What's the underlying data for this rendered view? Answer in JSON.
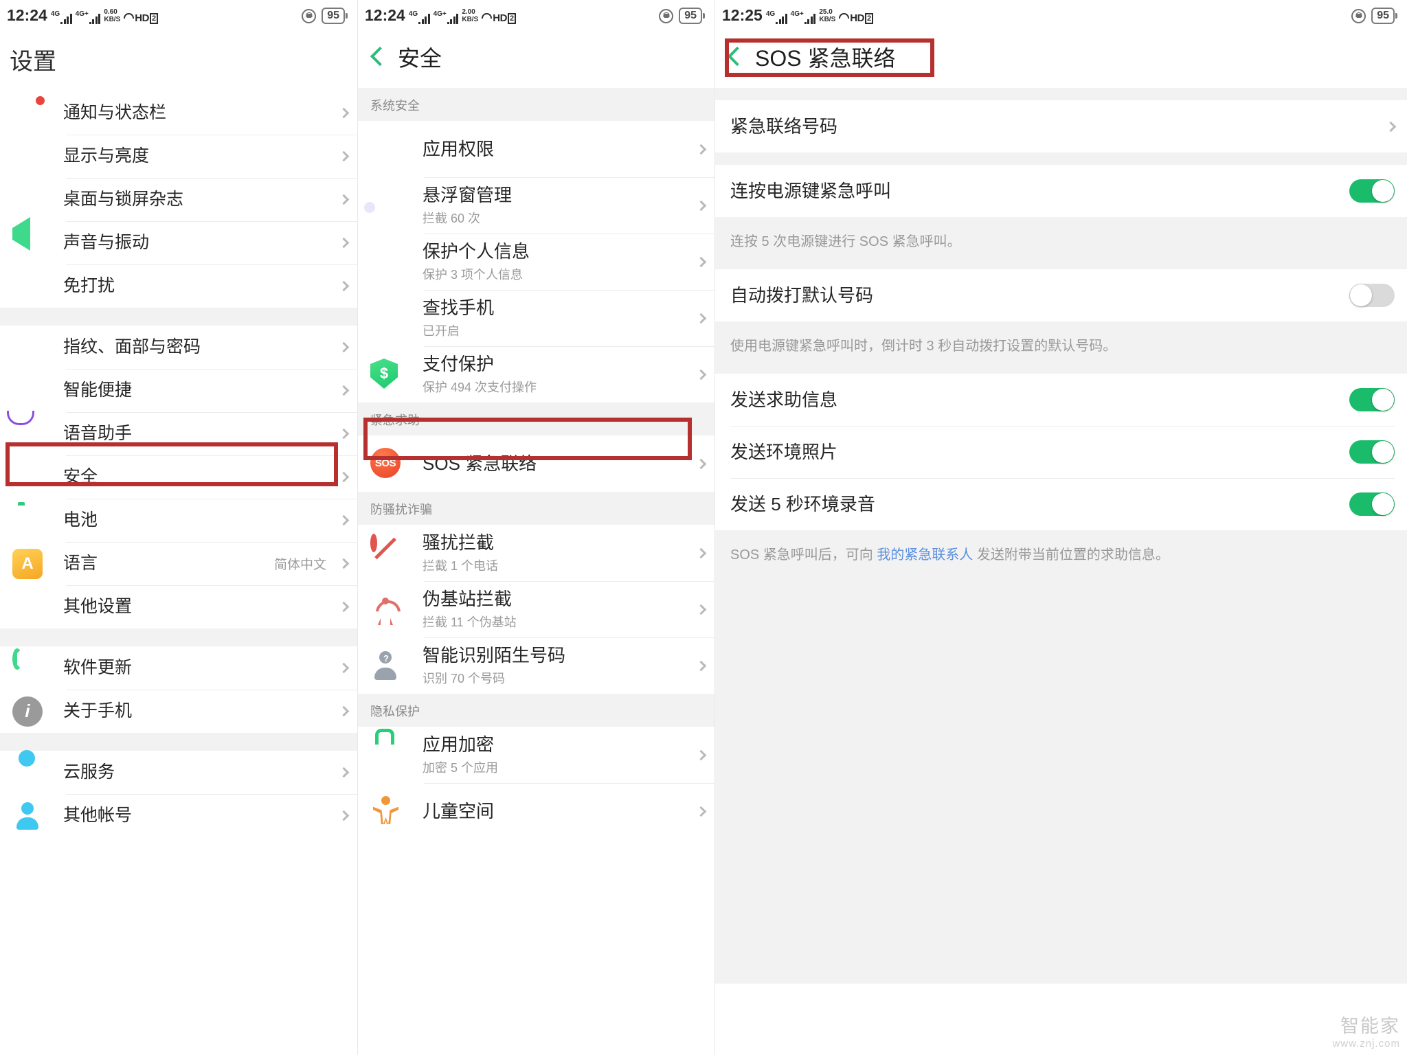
{
  "panels": [
    {
      "status": {
        "time": "12:24",
        "net_speed": "0.60",
        "net_unit": "KB/S",
        "sim1": "4G",
        "sim2": "4G+",
        "volte": "HD",
        "sim_badge": "2",
        "battery": "95"
      },
      "title": "设置",
      "groups": [
        {
          "items": [
            {
              "label": "通知与状态栏",
              "icon": "notification-icon",
              "badge": true
            },
            {
              "label": "显示与亮度",
              "icon": "display-brightness-icon"
            },
            {
              "label": "桌面与锁屏杂志",
              "icon": "wallpaper-icon"
            },
            {
              "label": "声音与振动",
              "icon": "sound-vibration-icon"
            },
            {
              "label": "免打扰",
              "icon": "do-not-disturb-moon-icon"
            }
          ]
        },
        {
          "items": [
            {
              "label": "指纹、面部与密码",
              "icon": "fingerprint-face-icon"
            },
            {
              "label": "智能便捷",
              "icon": "smart-convenience-icon"
            },
            {
              "label": "语音助手",
              "icon": "voice-assistant-mic-icon"
            },
            {
              "label": "安全",
              "icon": "security-shield-icon",
              "highlighted": true
            },
            {
              "label": "电池",
              "icon": "battery-icon"
            },
            {
              "label": "语言",
              "icon": "language-icon",
              "value": "简体中文"
            },
            {
              "label": "其他设置",
              "icon": "gear-icon"
            }
          ]
        },
        {
          "items": [
            {
              "label": "软件更新",
              "icon": "software-update-icon"
            },
            {
              "label": "关于手机",
              "icon": "about-phone-info-icon"
            }
          ]
        },
        {
          "items": [
            {
              "label": "云服务",
              "icon": "cloud-icon"
            },
            {
              "label": "其他帐号",
              "icon": "account-person-icon"
            }
          ]
        }
      ]
    },
    {
      "status": {
        "time": "12:24",
        "net_speed": "2.00",
        "net_unit": "KB/S",
        "sim1": "4G",
        "sim2": "4G+",
        "volte": "HD",
        "sim_badge": "2",
        "battery": "95"
      },
      "title": "安全",
      "back_label": "返回",
      "groups": [
        {
          "header": "系统安全",
          "items": [
            {
              "label": "应用权限",
              "icon": "app-permission-shield-icon"
            },
            {
              "label": "悬浮窗管理",
              "sub": "拦截 60 次",
              "icon": "floating-window-icon"
            },
            {
              "label": "保护个人信息",
              "sub": "保护 3 项个人信息",
              "icon": "personal-info-shield-icon"
            },
            {
              "label": "查找手机",
              "sub": "已开启",
              "icon": "find-phone-icon"
            },
            {
              "label": "支付保护",
              "sub": "保护 494 次支付操作",
              "icon": "payment-protection-shield-icon"
            }
          ]
        },
        {
          "header": "紧急求助",
          "items": [
            {
              "label": "SOS 紧急联络",
              "icon": "sos-icon",
              "highlighted": true
            }
          ]
        },
        {
          "header": "防骚扰诈骗",
          "items": [
            {
              "label": "骚扰拦截",
              "sub": "拦截 1 个电话",
              "icon": "block-harassment-icon"
            },
            {
              "label": "伪基站拦截",
              "sub": "拦截 11 个伪基站",
              "icon": "fake-base-station-icon"
            },
            {
              "label": "智能识别陌生号码",
              "sub": "识别 70 个号码",
              "icon": "unknown-number-icon"
            }
          ]
        },
        {
          "header": "隐私保护",
          "items": [
            {
              "label": "应用加密",
              "sub": "加密 5 个应用",
              "icon": "app-lock-icon"
            },
            {
              "label": "儿童空间",
              "icon": "kids-space-icon"
            }
          ]
        }
      ]
    },
    {
      "status": {
        "time": "12:25",
        "net_speed": "25.0",
        "net_unit": "KB/S",
        "sim1": "4G",
        "sim2": "4G+",
        "volte": "HD",
        "sim_badge": "2",
        "battery": "95"
      },
      "title": "SOS 紧急联络",
      "back_label": "返回",
      "blocks": [
        {
          "type": "list",
          "items": [
            {
              "label": "紧急联络号码",
              "control": "chevron"
            }
          ]
        },
        {
          "type": "list",
          "items": [
            {
              "label": "连按电源键紧急呼叫",
              "control": "toggle",
              "state": "on"
            }
          ]
        },
        {
          "type": "hint",
          "text": "连按 5 次电源键进行 SOS 紧急呼叫。"
        },
        {
          "type": "list",
          "items": [
            {
              "label": "自动拨打默认号码",
              "control": "toggle",
              "state": "off"
            }
          ]
        },
        {
          "type": "hint",
          "text": "使用电源键紧急呼叫时，倒计时 3 秒自动拨打设置的默认号码。"
        },
        {
          "type": "list",
          "items": [
            {
              "label": "发送求助信息",
              "control": "toggle",
              "state": "on"
            },
            {
              "label": "发送环境照片",
              "control": "toggle",
              "state": "on"
            },
            {
              "label": "发送 5 秒环境录音",
              "control": "toggle",
              "state": "on"
            }
          ]
        },
        {
          "type": "hint_link",
          "pre": "SOS 紧急呼叫后，可向 ",
          "link": "我的紧急联系人",
          "post": " 发送附带当前位置的求助信息。"
        }
      ]
    }
  ],
  "watermark": {
    "line1": "智能家",
    "line2": "www.znj.com"
  },
  "colors": {
    "accent_green": "#1abc6b",
    "annotation_red": "#b5302f",
    "link_blue": "#5b8fe0"
  }
}
